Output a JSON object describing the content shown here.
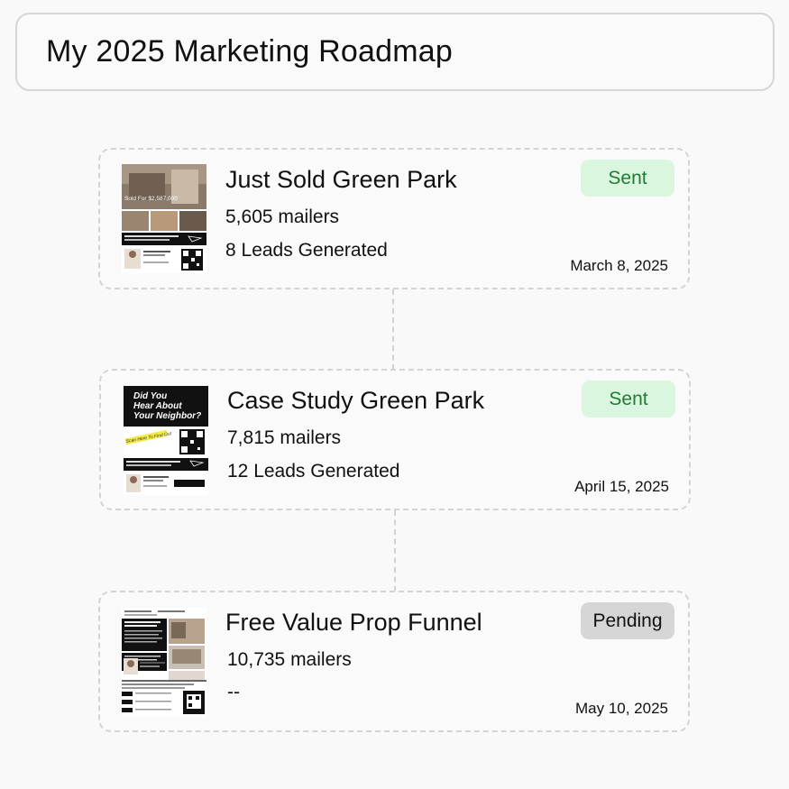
{
  "header": {
    "title": "My 2025 Marketing Roadmap"
  },
  "campaigns": [
    {
      "title": "Just Sold Green Park",
      "mailers": "5,605 mailers",
      "leads": "8 Leads Generated",
      "date": "March 8, 2025",
      "status": "Sent",
      "status_color": "#dbf6df",
      "thumb": {
        "price_text": "Sold For $2,587,000"
      }
    },
    {
      "title": "Case Study Green Park",
      "mailers": "7,815 mailers",
      "leads": "12 Leads Generated",
      "date": "April 15, 2025",
      "status": "Sent",
      "status_color": "#dbf6df",
      "thumb": {
        "headline_1": "Did You",
        "headline_2": "Hear About",
        "headline_3": "Your Neighbor?",
        "handwriting": "Scan Here To Find Out"
      }
    },
    {
      "title": "Free Value Prop Funnel",
      "mailers": "10,735 mailers",
      "leads": "--",
      "date": "May 10, 2025",
      "status": "Pending",
      "status_color": "#d6d6d6",
      "thumb": {}
    }
  ]
}
